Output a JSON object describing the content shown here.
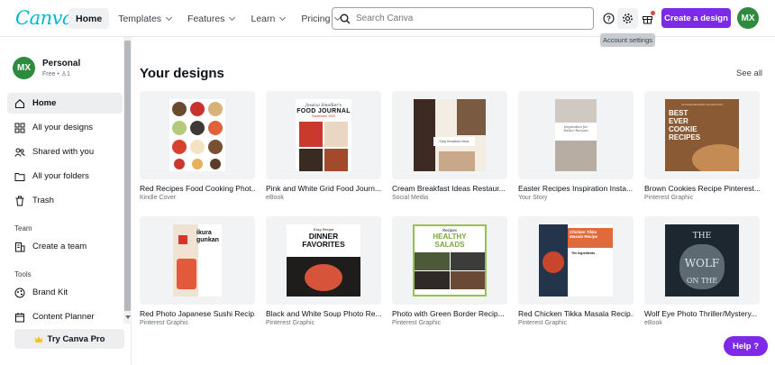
{
  "header": {
    "logo": "Canva",
    "nav": [
      {
        "label": "Home",
        "active": true,
        "dropdown": false
      },
      {
        "label": "Templates",
        "dropdown": true
      },
      {
        "label": "Features",
        "dropdown": true
      },
      {
        "label": "Learn",
        "dropdown": true
      },
      {
        "label": "Pricing",
        "dropdown": true
      }
    ],
    "search_placeholder": "Search Canva",
    "tooltip": "Account settings",
    "create_button": "Create a design",
    "avatar_initials": "MX"
  },
  "sidebar": {
    "profile": {
      "initials": "MX",
      "name": "Personal",
      "sub": "Free • ♙1"
    },
    "items": [
      {
        "label": "Home",
        "icon": "home-icon"
      },
      {
        "label": "All your designs",
        "icon": "grid-icon"
      },
      {
        "label": "Shared with you",
        "icon": "people-icon"
      },
      {
        "label": "All your folders",
        "icon": "folder-icon"
      },
      {
        "label": "Trash",
        "icon": "trash-icon"
      }
    ],
    "team_heading": "Team",
    "team_items": [
      {
        "label": "Create a team",
        "icon": "building-icon"
      }
    ],
    "tools_heading": "Tools",
    "tools_items": [
      {
        "label": "Brand Kit",
        "icon": "brand-kit-icon"
      },
      {
        "label": "Content Planner",
        "icon": "calendar-icon"
      }
    ],
    "try_pro": "Try Canva Pro",
    "try_pro_icon": "crown-icon"
  },
  "main": {
    "title": "Your designs",
    "see_all": "See all",
    "designs": [
      {
        "title": "Red Recipes Food Cooking Phot...",
        "type": "Kindle Cover"
      },
      {
        "title": "Pink and White Grid Food Journ...",
        "type": "eBook"
      },
      {
        "title": "Cream Breakfast Ideas Restaur...",
        "type": "Social Media"
      },
      {
        "title": "Easter Recipes Inspiration Insta...",
        "type": "Your Story"
      },
      {
        "title": "Brown Cookies Recipe Pinterest...",
        "type": "Pinterest Graphic"
      },
      {
        "title": "Red Photo Japanese Sushi Recip...",
        "type": "Pinterest Graphic"
      },
      {
        "title": "Black and White Soup Photo Re...",
        "type": "Pinterest Graphic"
      },
      {
        "title": "Photo with Green Border Recip...",
        "type": "Pinterest Graphic"
      },
      {
        "title": "Red Chicken Tikka Masala Recip...",
        "type": "Pinterest Graphic"
      },
      {
        "title": "Wolf Eye Photo Thriller/Mystery...",
        "type": "eBook"
      }
    ],
    "thumb_text": {
      "journal_author": "Jessica Smollier's",
      "journal_title": "FOOD JOURNAL",
      "journal_date": "September 2029",
      "breakfast": "Easy Breakfast Ideas",
      "easter": "Inspiration for Easter Recipes",
      "cookie": "BEST EVER COOKIE RECIPES",
      "cookie_sub": "COOKIE RECIPES COLLECTION",
      "sushi_line1": "ikura",
      "sushi_line2": "gunkan",
      "soup_small": "Easy Recipe",
      "soup_title": "DINNER FAVORITES",
      "salad_small": "Recipes",
      "salad_title": "HEALTHY SALADS",
      "tikka": "Chicken Tikka Masala Recipe",
      "tikka_sub": "The Ingredients",
      "wolf_1": "THE",
      "wolf_2": "WOLF",
      "wolf_3": "ON THE"
    }
  },
  "help_button": "Help ?"
}
